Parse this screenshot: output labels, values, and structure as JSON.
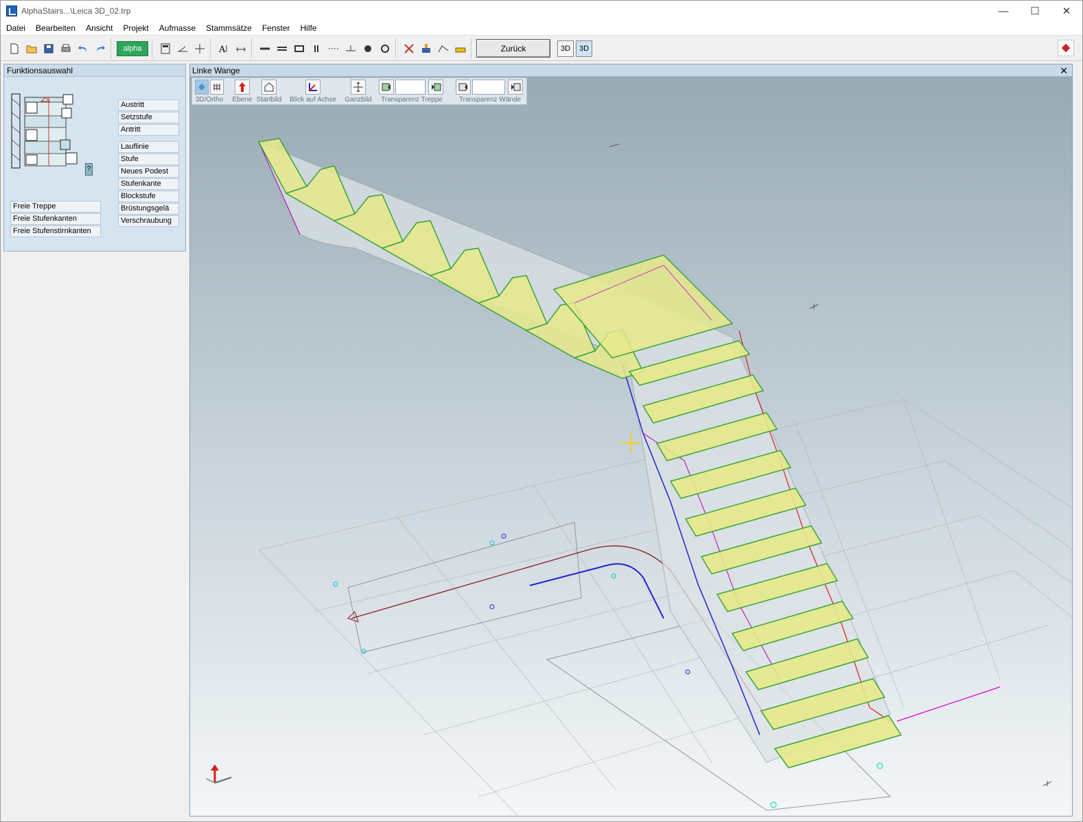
{
  "window": {
    "title": "AlphaStairs...\\Leica 3D_02.trp"
  },
  "menu": [
    "Datei",
    "Bearbeiten",
    "Ansicht",
    "Projekt",
    "Aufmasse",
    "Stammsätze",
    "Fenster",
    "Hilfe"
  ],
  "toolbar": {
    "alpha_label": "alpha",
    "zurueck_label": "Zurück",
    "view3d_label": "3D",
    "view3d_alt_label": "3D"
  },
  "left_panel": {
    "title": "Funktionsauswahl",
    "help_label": "?",
    "buttons_top": [
      "Austritt",
      "Setzstufe",
      "Antritt"
    ],
    "buttons_mid": [
      "Lauflinie",
      "Stufe",
      "Neues Podest",
      "Stufenkante",
      "Blockstufe",
      "Brüstungsgelä",
      "Verschraubung"
    ],
    "buttons_left": [
      "Freie Treppe",
      "Freie Stufenkanten",
      "Freie Stufenstirnkanten"
    ]
  },
  "viewport": {
    "title": "Linke Wange",
    "close_label": "✕",
    "tools": [
      "3D/Ortho",
      "Ebene",
      "Startbild",
      "Blick auf Achse",
      "Ganzbild",
      "Transparenz Treppe",
      "Transparenz Wände"
    ]
  },
  "colors": {
    "step_fill": "#e6e98a",
    "step_edge": "#3aa33a",
    "bg_top": "#98aab4",
    "bg_bottom": "#f4f7f8",
    "axis_red": "#d81e1e"
  }
}
